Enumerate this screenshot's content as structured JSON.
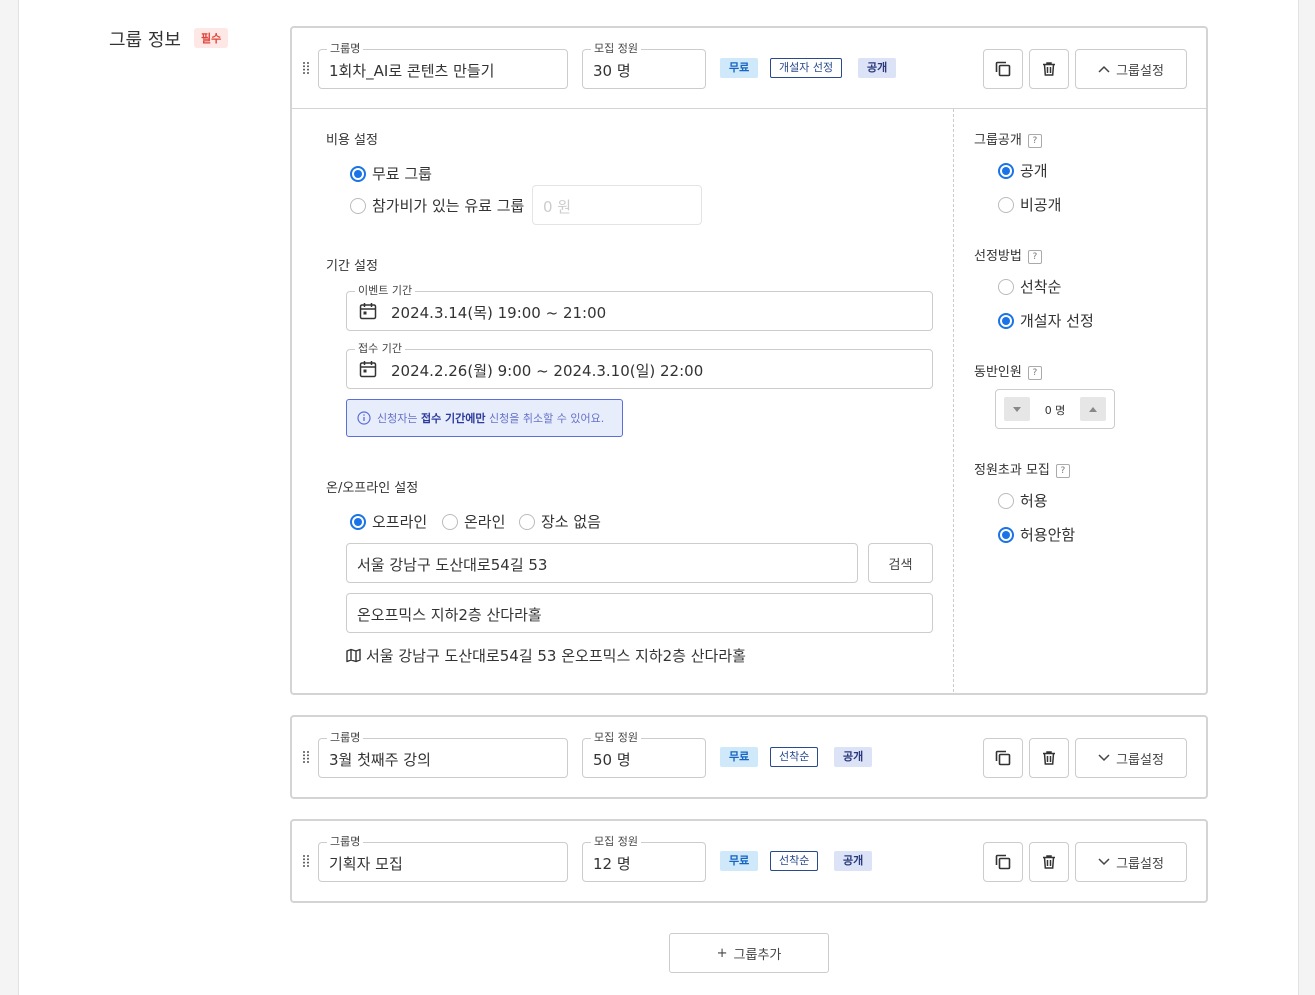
{
  "section": {
    "title": "그룹 정보",
    "required_badge": "필수"
  },
  "groups": [
    {
      "name_legend": "그룹명",
      "name": "1회차_AI로 콘텐츠 만들기",
      "capacity_legend": "모집 정원",
      "capacity": "30 명",
      "tags": [
        "무료",
        "개설자 선정",
        "공개"
      ],
      "toggle_label": "그룹설정",
      "expanded": true
    },
    {
      "name_legend": "그룹명",
      "name": "3월 첫째주 강의",
      "capacity_legend": "모집 정원",
      "capacity": "50 명",
      "tags": [
        "무료",
        "선착순",
        "공개"
      ],
      "toggle_label": "그룹설정",
      "expanded": false
    },
    {
      "name_legend": "그룹명",
      "name": "기획자 모집",
      "capacity_legend": "모집 정원",
      "capacity": "12 명",
      "tags": [
        "무료",
        "선착순",
        "공개"
      ],
      "toggle_label": "그룹설정",
      "expanded": false
    }
  ],
  "cost": {
    "title": "비용 설정",
    "options": [
      "무료 그룹",
      "참가비가 있는 유료 그룹"
    ],
    "selected": 0,
    "fee_placeholder": "0 원"
  },
  "period": {
    "title": "기간 설정",
    "event_legend": "이벤트 기간",
    "event_value": "2024.3.14(목) 19:00 ~ 21:00",
    "apply_legend": "접수 기간",
    "apply_value": "2024.2.26(월) 9:00 ~ 2024.3.10(일) 22:00",
    "notice_pre": "신청자는",
    "notice_bold": "접수 기간에만",
    "notice_post": "신청을 취소할 수 있어요."
  },
  "location": {
    "title": "온/오프라인 설정",
    "options": [
      "오프라인",
      "온라인",
      "장소 없음"
    ],
    "selected": 0,
    "address": "서울 강남구 도산대로54길 53",
    "search_label": "검색",
    "detail": "온오프믹스 지하2층 산다라홀",
    "full_address": "서울 강남구 도산대로54길 53 온오프믹스 지하2층 산다라홀"
  },
  "settings": {
    "visibility": {
      "title": "그룹공개",
      "options": [
        "공개",
        "비공개"
      ],
      "selected": 0
    },
    "selection": {
      "title": "선정방법",
      "options": [
        "선착순",
        "개설자 선정"
      ],
      "selected": 1
    },
    "companion": {
      "title": "동반인원",
      "value": "0 명"
    },
    "overflow": {
      "title": "정원초과 모집",
      "options": [
        "허용",
        "허용안함"
      ],
      "selected": 1
    },
    "help_mark": "?"
  },
  "add_group_label": "그룹추가",
  "colors": {
    "accent": "#1a73e8",
    "required": "#e0453a"
  }
}
